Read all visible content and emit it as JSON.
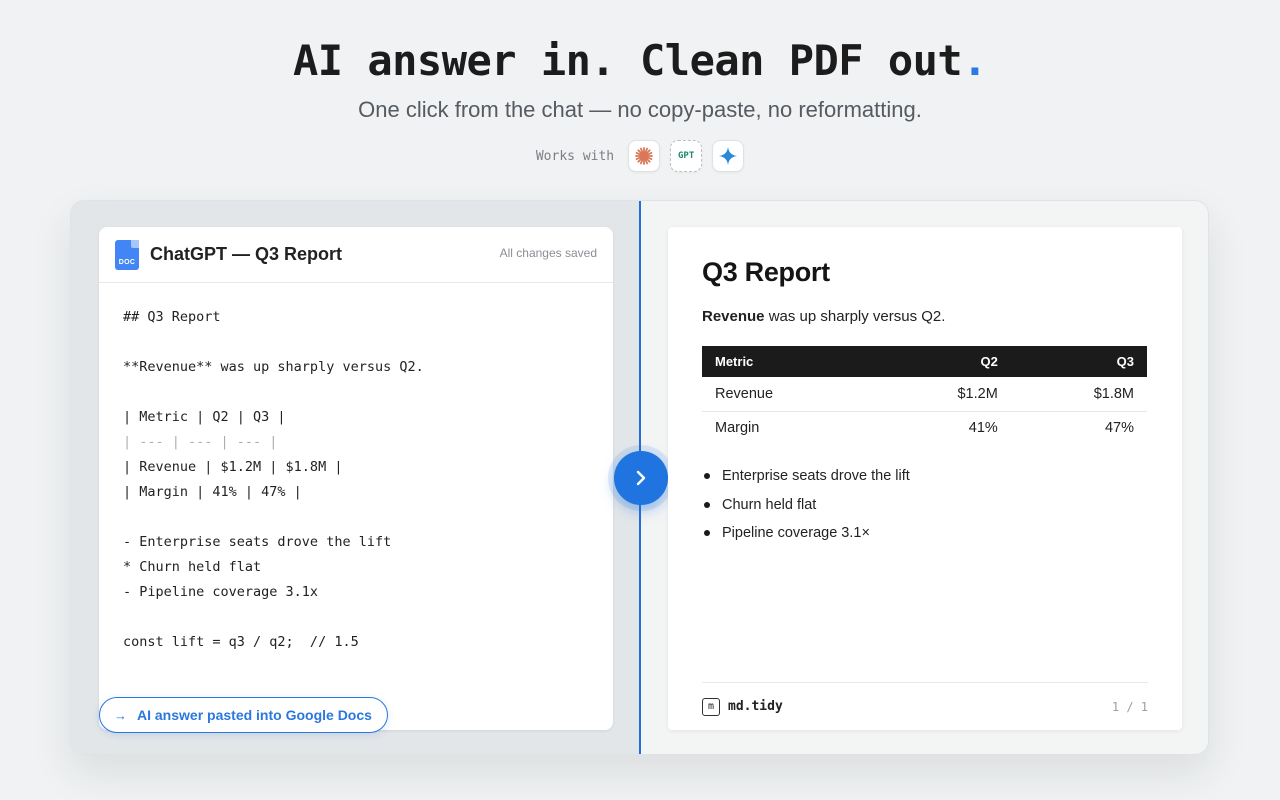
{
  "hero": {
    "title": "AI answer in. Clean PDF out",
    "title_dot": ".",
    "subtitle": "One click from the chat — no copy-paste, no reformatting.",
    "works_with_label": "Works with",
    "integrations": [
      {
        "name": "claude-icon",
        "color": "#d97757"
      },
      {
        "name": "chatgpt-icon",
        "label": "GPT",
        "color": "#1c8a6c"
      },
      {
        "name": "gemini-icon",
        "color": "#2a8ad8"
      }
    ]
  },
  "editor": {
    "doc_icon_label": "DOC",
    "title": "ChatGPT — Q3 Report",
    "status": "All changes saved",
    "lines": [
      "## Q3 Report",
      "",
      "**Revenue** was up sharply versus Q2.",
      "",
      "| Metric | Q2 | Q3 |",
      "| --- | --- | --- |",
      "| Revenue | $1.2M | $1.8M |",
      "| Margin | 41% | 47% |",
      "",
      "- Enterprise seats drove the lift",
      "* Churn held flat",
      "- Pipeline coverage 3.1x",
      "",
      "const lift = q3 / q2;  // 1.5"
    ],
    "pasted_pill": "AI answer pasted into Google Docs",
    "pill_arrow": "→"
  },
  "convert_button": {
    "icon": "chevron-right-icon",
    "color": "#1f74e0"
  },
  "pdf": {
    "heading": "Q3 Report",
    "para_bold": "Revenue",
    "para_rest": " was up sharply versus Q2.",
    "table": {
      "headers": [
        "Metric",
        "Q2",
        "Q3"
      ],
      "rows": [
        [
          "Revenue",
          "$1.2M",
          "$1.8M"
        ],
        [
          "Margin",
          "41%",
          "47%"
        ]
      ]
    },
    "bullets": [
      "Enterprise seats drove the lift",
      "Churn held flat",
      "Pipeline coverage 3.1×"
    ],
    "footer": {
      "badge": "m",
      "brand": "md.tidy",
      "page": "1 / 1"
    }
  },
  "colors": {
    "accent": "#2a7ae2",
    "divider": "#1f6fd6"
  }
}
